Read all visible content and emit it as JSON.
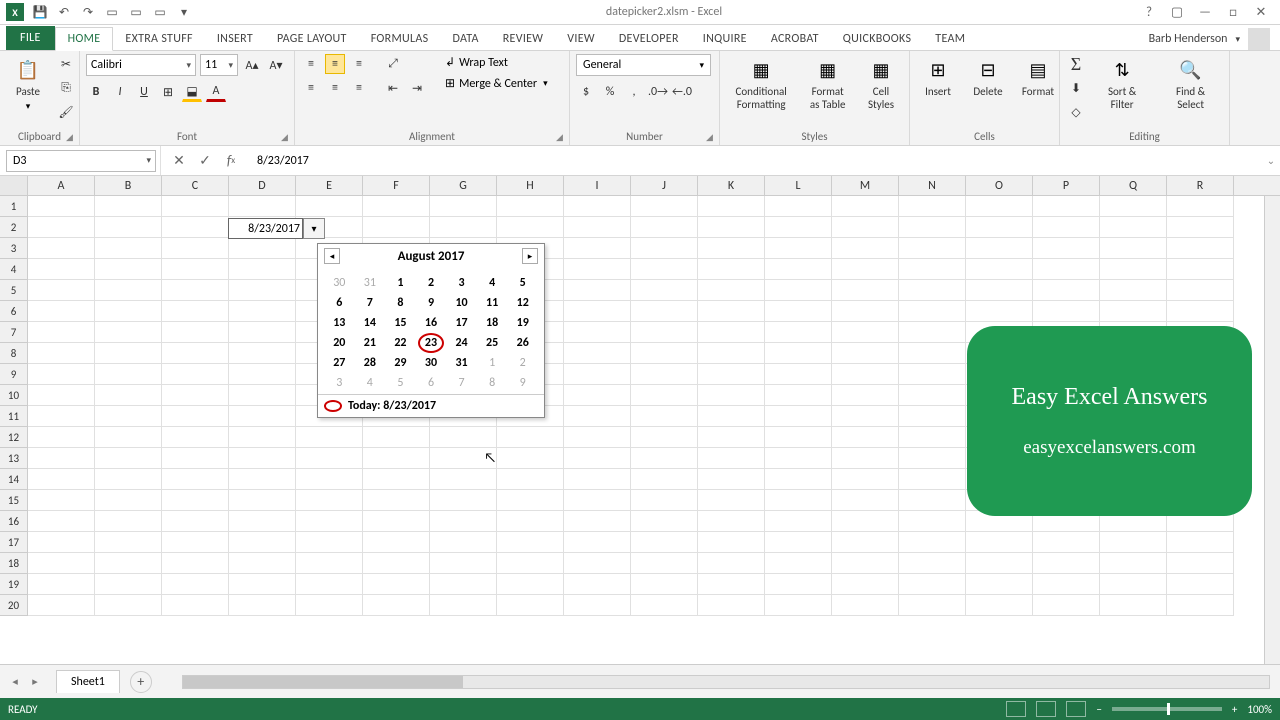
{
  "title": "datepicker2.xlsm - Excel",
  "user": "Barb Henderson",
  "tabs": [
    "FILE",
    "HOME",
    "extra stuff",
    "INSERT",
    "PAGE LAYOUT",
    "FORMULAS",
    "DATA",
    "REVIEW",
    "VIEW",
    "DEVELOPER",
    "INQUIRE",
    "ACROBAT",
    "QuickBooks",
    "TEAM"
  ],
  "active_tab": 1,
  "ribbon": {
    "clipboard": {
      "paste": "Paste",
      "label": "Clipboard"
    },
    "font": {
      "name": "Calibri",
      "size": "11",
      "label": "Font"
    },
    "alignment": {
      "wrap": "Wrap Text",
      "merge": "Merge & Center",
      "label": "Alignment"
    },
    "number": {
      "format": "General",
      "label": "Number"
    },
    "styles": {
      "cond": "Conditional\nFormatting",
      "table": "Format as\nTable",
      "cell": "Cell\nStyles",
      "label": "Styles"
    },
    "cells": {
      "insert": "Insert",
      "delete": "Delete",
      "format": "Format",
      "label": "Cells"
    },
    "editing": {
      "sort": "Sort &\nFilter",
      "find": "Find &\nSelect",
      "label": "Editing"
    }
  },
  "namebox": "D3",
  "formula": "8/23/2017",
  "cell_d3": "8/23/2017",
  "columns": [
    "A",
    "B",
    "C",
    "D",
    "E",
    "F",
    "G",
    "H",
    "I",
    "J",
    "K",
    "L",
    "M",
    "N",
    "O",
    "P",
    "Q",
    "R"
  ],
  "row_count": 20,
  "calendar": {
    "title": "August 2017",
    "days": [
      {
        "n": "30",
        "o": true
      },
      {
        "n": "31",
        "o": true
      },
      {
        "n": "1"
      },
      {
        "n": "2"
      },
      {
        "n": "3"
      },
      {
        "n": "4"
      },
      {
        "n": "5"
      },
      {
        "n": "6"
      },
      {
        "n": "7"
      },
      {
        "n": "8"
      },
      {
        "n": "9"
      },
      {
        "n": "10"
      },
      {
        "n": "11"
      },
      {
        "n": "12"
      },
      {
        "n": "13"
      },
      {
        "n": "14"
      },
      {
        "n": "15"
      },
      {
        "n": "16"
      },
      {
        "n": "17"
      },
      {
        "n": "18"
      },
      {
        "n": "19"
      },
      {
        "n": "20"
      },
      {
        "n": "21"
      },
      {
        "n": "22"
      },
      {
        "n": "23",
        "t": true
      },
      {
        "n": "24"
      },
      {
        "n": "25"
      },
      {
        "n": "26"
      },
      {
        "n": "27"
      },
      {
        "n": "28"
      },
      {
        "n": "29"
      },
      {
        "n": "30"
      },
      {
        "n": "31"
      },
      {
        "n": "1",
        "o": true
      },
      {
        "n": "2",
        "o": true
      },
      {
        "n": "3",
        "o": true
      },
      {
        "n": "4",
        "o": true
      },
      {
        "n": "5",
        "o": true
      },
      {
        "n": "6",
        "o": true
      },
      {
        "n": "7",
        "o": true
      },
      {
        "n": "8",
        "o": true
      },
      {
        "n": "9",
        "o": true
      }
    ],
    "today": "Today: 8/23/2017"
  },
  "promo": {
    "title": "Easy Excel Answers",
    "url": "easyexcelanswers.com"
  },
  "sheet": "Sheet1",
  "status": "READY",
  "zoom": "100%"
}
